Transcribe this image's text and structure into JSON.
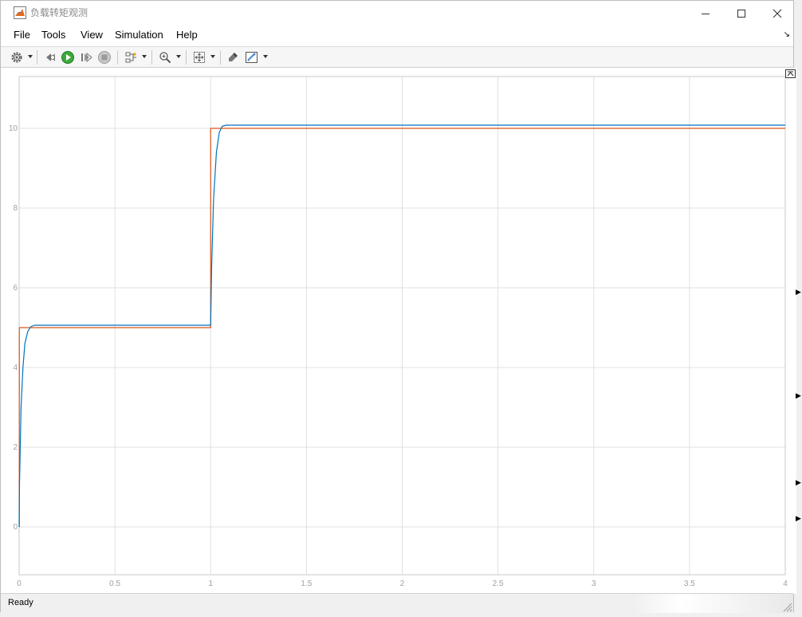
{
  "window": {
    "title": "负载转矩观测"
  },
  "menu": {
    "items": [
      "File",
      "Tools",
      "View",
      "Simulation",
      "Help"
    ]
  },
  "toolbar": {
    "icons": [
      "gear-icon",
      "step-back-icon",
      "run-icon",
      "step-forward-icon",
      "stop-icon",
      "signal-select-icon",
      "zoom-icon",
      "fit-view-icon",
      "style-icon",
      "measure-icon"
    ]
  },
  "status": {
    "text": "Ready"
  },
  "colors": {
    "series_reference": "#d95319",
    "series_observed": "#0072bd",
    "grid": "#e0e0e0",
    "axis": "#c8c8c8",
    "tick_text": "#a0a0a0"
  },
  "chart_data": {
    "type": "line",
    "title": "",
    "xlabel": "",
    "ylabel": "",
    "xlim": [
      0,
      4
    ],
    "ylim": [
      -1.2,
      11.3
    ],
    "xticks": [
      0,
      0.5,
      1,
      1.5,
      2,
      2.5,
      3,
      3.5,
      4
    ],
    "xtick_labels": [
      "0",
      "0.5",
      "1",
      "1.5",
      "2",
      "2.5",
      "3",
      "3.5",
      "4"
    ],
    "yticks": [
      0,
      2,
      4,
      6,
      8,
      10
    ],
    "ytick_labels": [
      "0",
      "2",
      "4",
      "6",
      "8",
      "10"
    ],
    "grid": true,
    "legend": "none",
    "series": [
      {
        "x": [
          0,
          0.001,
          0.001,
          1.0,
          1.0,
          4.0
        ],
        "y": [
          0,
          0,
          5.0,
          5.0,
          10.0,
          10.0
        ]
      },
      {
        "x": [
          0,
          0.002,
          0.01,
          0.02,
          0.03,
          0.045,
          0.06,
          0.08,
          0.1,
          0.5,
          1.0,
          1.005,
          1.015,
          1.03,
          1.045,
          1.06,
          1.08,
          1.1,
          1.2,
          4.0
        ],
        "y": [
          0,
          1.1,
          3.0,
          4.0,
          4.6,
          4.9,
          5.02,
          5.06,
          5.06,
          5.06,
          5.06,
          6.5,
          8.2,
          9.4,
          9.9,
          10.05,
          10.08,
          10.08,
          10.08,
          10.08
        ]
      }
    ]
  }
}
